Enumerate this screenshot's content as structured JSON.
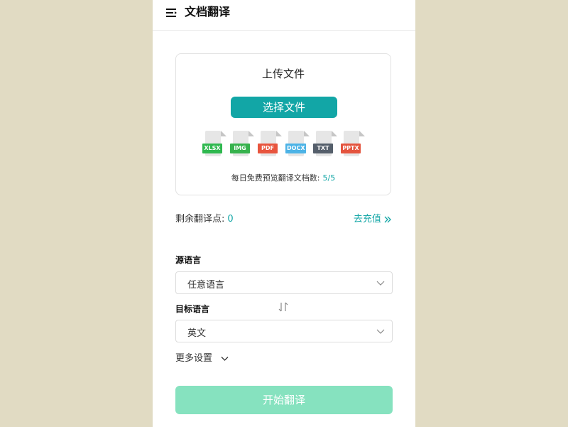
{
  "header": {
    "title": "文档翻译",
    "menu_icon": "hamburger-icon"
  },
  "upload": {
    "title": "上传文件",
    "choose_label": "选择文件",
    "file_types": [
      {
        "label": "XLSX",
        "color": "#2fb84f"
      },
      {
        "label": "IMG",
        "color": "#37b24d"
      },
      {
        "label": "PDF",
        "color": "#e8553e"
      },
      {
        "label": "DOCX",
        "color": "#4db3e6"
      },
      {
        "label": "TXT",
        "color": "#555f6b"
      },
      {
        "label": "PPTX",
        "color": "#e4543e"
      }
    ],
    "quota_label": "每日免费预览翻译文档数:",
    "quota_value": "5/5"
  },
  "points": {
    "label": "剩余翻译点:",
    "value": "0",
    "recharge_label": "去充值",
    "recharge_icon": "double-chevron-right-icon"
  },
  "source_lang": {
    "label": "源语言",
    "value": "任意语言"
  },
  "target_lang": {
    "label": "目标语言",
    "value": "英文"
  },
  "swap_icon": "swap-arrows-icon",
  "more_settings": {
    "label": "更多设置"
  },
  "start_button": {
    "label": "开始翻译"
  },
  "colors": {
    "accent": "#12a6a6",
    "start_disabled": "#86e2bf",
    "page_bg": "#e1dbc3"
  }
}
